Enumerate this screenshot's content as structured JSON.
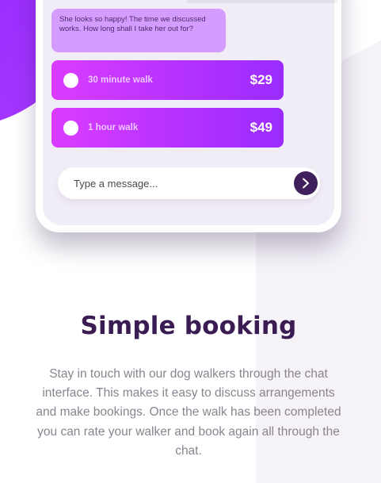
{
  "chat": {
    "bubble_text": "She looks so happy! The time we discussed works. How long shall I take her out for?",
    "options": [
      {
        "label": "30 minute walk",
        "price": "$29"
      },
      {
        "label": "1 hour walk",
        "price": "$49"
      }
    ],
    "input_placeholder": "Type a message..."
  },
  "section": {
    "title": "Simple booking",
    "description": "Stay in touch with our dog walkers through the chat interface. This makes it easy to discuss arrangements and make bookings. Once the walk has been completed you can rate your walker and book again all through the chat."
  },
  "colors": {
    "accent_purple": "#9a2bff",
    "option_gradient_start": "#db3cff",
    "title": "#3a1c52",
    "send_button": "#3f1f5c"
  },
  "icons": {
    "send": "chevron-right-icon"
  }
}
